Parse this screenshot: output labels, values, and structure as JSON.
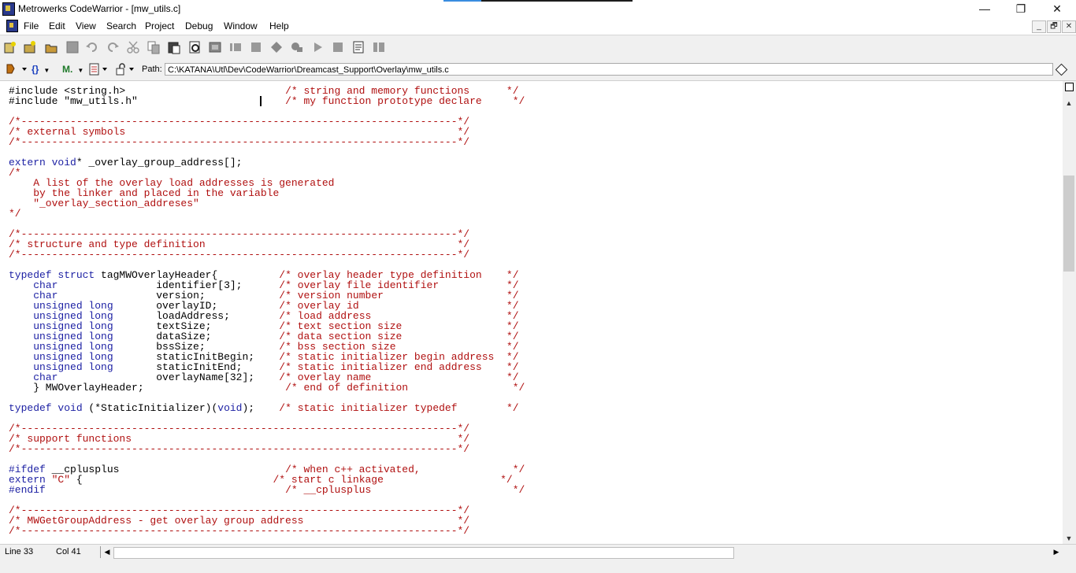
{
  "window": {
    "title": "Metrowerks CodeWarrior - [mw_utils.c]",
    "minimize": "—",
    "restore": "❐",
    "close": "✕"
  },
  "menu": {
    "items": [
      "File",
      "Edit",
      "View",
      "Search",
      "Project",
      "Debug",
      "Window",
      "Help"
    ],
    "mdi_min": "_",
    "mdi_restore": "🗗",
    "mdi_close": "✕"
  },
  "toolbar": {
    "icons": [
      "new-project-icon",
      "new-file-icon",
      "open-icon",
      "save-icon",
      "undo-icon",
      "redo-icon",
      "cut-icon",
      "copy-icon",
      "paste-icon",
      "find-icon",
      "find-in-files-icon",
      "make-icon",
      "stop-icon",
      "debug-icon",
      "run-icon",
      "break-icon",
      "project-window-icon",
      "browser-icon"
    ]
  },
  "pathbar": {
    "h_label": "h",
    "braces_label": "{}",
    "m_label": "M.",
    "path_label": "Path:",
    "path_value": "C:\\KATANA\\Utl\\Dev\\CodeWarrior\\Dreamcast_Support\\Overlay\\mw_utils.c"
  },
  "colors": {
    "keyword": "#1b1fa3",
    "comment": "#b01010",
    "text": "#000000"
  },
  "code_lines": [
    [
      [
        "t",
        "#include <string.h>                          "
      ],
      [
        "c",
        "/* string and memory functions      */"
      ]
    ],
    [
      [
        "t",
        "#include \"mw_utils.h\"                        "
      ],
      [
        "c",
        "/* my function prototype declare     */"
      ]
    ],
    [
      [
        "t",
        ""
      ]
    ],
    [
      [
        "c",
        "/*-----------------------------------------------------------------------*/"
      ]
    ],
    [
      [
        "c",
        "/* external symbols                                                      */"
      ]
    ],
    [
      [
        "c",
        "/*-----------------------------------------------------------------------*/"
      ]
    ],
    [
      [
        "t",
        ""
      ]
    ],
    [
      [
        "k",
        "extern void"
      ],
      [
        "t",
        "* _overlay_group_address[];"
      ]
    ],
    [
      [
        "c",
        "/*"
      ]
    ],
    [
      [
        "c",
        "    A list of the overlay load addresses is generated"
      ]
    ],
    [
      [
        "c",
        "    by the linker and placed in the variable"
      ]
    ],
    [
      [
        "c",
        "    \"_overlay_section_addreses\""
      ]
    ],
    [
      [
        "c",
        "*/"
      ]
    ],
    [
      [
        "t",
        ""
      ]
    ],
    [
      [
        "c",
        "/*-----------------------------------------------------------------------*/"
      ]
    ],
    [
      [
        "c",
        "/* structure and type definition                                         */"
      ]
    ],
    [
      [
        "c",
        "/*-----------------------------------------------------------------------*/"
      ]
    ],
    [
      [
        "t",
        ""
      ]
    ],
    [
      [
        "k",
        "typedef struct"
      ],
      [
        "t",
        " tagMWOverlayHeader{          "
      ],
      [
        "c",
        "/* overlay header type definition    */"
      ]
    ],
    [
      [
        "t",
        "    "
      ],
      [
        "k",
        "char"
      ],
      [
        "t",
        "                identifier[3];      "
      ],
      [
        "c",
        "/* overlay file identifier           */"
      ]
    ],
    [
      [
        "t",
        "    "
      ],
      [
        "k",
        "char"
      ],
      [
        "t",
        "                version;            "
      ],
      [
        "c",
        "/* version number                    */"
      ]
    ],
    [
      [
        "t",
        "    "
      ],
      [
        "k",
        "unsigned long"
      ],
      [
        "t",
        "       overlayID;          "
      ],
      [
        "c",
        "/* overlay id                        */"
      ]
    ],
    [
      [
        "t",
        "    "
      ],
      [
        "k",
        "unsigned long"
      ],
      [
        "t",
        "       loadAddress;        "
      ],
      [
        "c",
        "/* load address                      */"
      ]
    ],
    [
      [
        "t",
        "    "
      ],
      [
        "k",
        "unsigned long"
      ],
      [
        "t",
        "       textSize;           "
      ],
      [
        "c",
        "/* text section size                 */"
      ]
    ],
    [
      [
        "t",
        "    "
      ],
      [
        "k",
        "unsigned long"
      ],
      [
        "t",
        "       dataSize;           "
      ],
      [
        "c",
        "/* data section size                 */"
      ]
    ],
    [
      [
        "t",
        "    "
      ],
      [
        "k",
        "unsigned long"
      ],
      [
        "t",
        "       bssSize;            "
      ],
      [
        "c",
        "/* bss section size                  */"
      ]
    ],
    [
      [
        "t",
        "    "
      ],
      [
        "k",
        "unsigned long"
      ],
      [
        "t",
        "       staticInitBegin;    "
      ],
      [
        "c",
        "/* static initializer begin address  */"
      ]
    ],
    [
      [
        "t",
        "    "
      ],
      [
        "k",
        "unsigned long"
      ],
      [
        "t",
        "       staticInitEnd;      "
      ],
      [
        "c",
        "/* static initializer end address    */"
      ]
    ],
    [
      [
        "t",
        "    "
      ],
      [
        "k",
        "char"
      ],
      [
        "t",
        "                overlayName[32];    "
      ],
      [
        "c",
        "/* overlay name                      */"
      ]
    ],
    [
      [
        "t",
        "    } MWOverlayHeader;                       "
      ],
      [
        "c",
        "/* end of definition                 */"
      ]
    ],
    [
      [
        "t",
        ""
      ]
    ],
    [
      [
        "k",
        "typedef void"
      ],
      [
        "t",
        " (*StaticInitializer)("
      ],
      [
        "k",
        "void"
      ],
      [
        "t",
        ");    "
      ],
      [
        "c",
        "/* static initializer typedef        */"
      ]
    ],
    [
      [
        "t",
        ""
      ]
    ],
    [
      [
        "c",
        "/*-----------------------------------------------------------------------*/"
      ]
    ],
    [
      [
        "c",
        "/* support functions                                                     */"
      ]
    ],
    [
      [
        "c",
        "/*-----------------------------------------------------------------------*/"
      ]
    ],
    [
      [
        "t",
        ""
      ]
    ],
    [
      [
        "k",
        "#ifdef"
      ],
      [
        "t",
        " __cplusplus                           "
      ],
      [
        "c",
        "/* when c++ activated,               */"
      ]
    ],
    [
      [
        "k",
        "extern"
      ],
      [
        "t",
        " "
      ],
      [
        "c",
        "\"C\""
      ],
      [
        "t",
        " {                               "
      ],
      [
        "c",
        "/* start c linkage                   */"
      ]
    ],
    [
      [
        "k",
        "#endif"
      ],
      [
        "t",
        "                                       "
      ],
      [
        "c",
        "/* __cplusplus                       */"
      ]
    ],
    [
      [
        "t",
        ""
      ]
    ],
    [
      [
        "c",
        "/*-----------------------------------------------------------------------*/"
      ]
    ],
    [
      [
        "c",
        "/* MWGetGroupAddress - get overlay group address                         */"
      ]
    ],
    [
      [
        "c",
        "/*-----------------------------------------------------------------------*/"
      ]
    ]
  ],
  "status": {
    "line": "Line 33",
    "col": "Col 41"
  }
}
